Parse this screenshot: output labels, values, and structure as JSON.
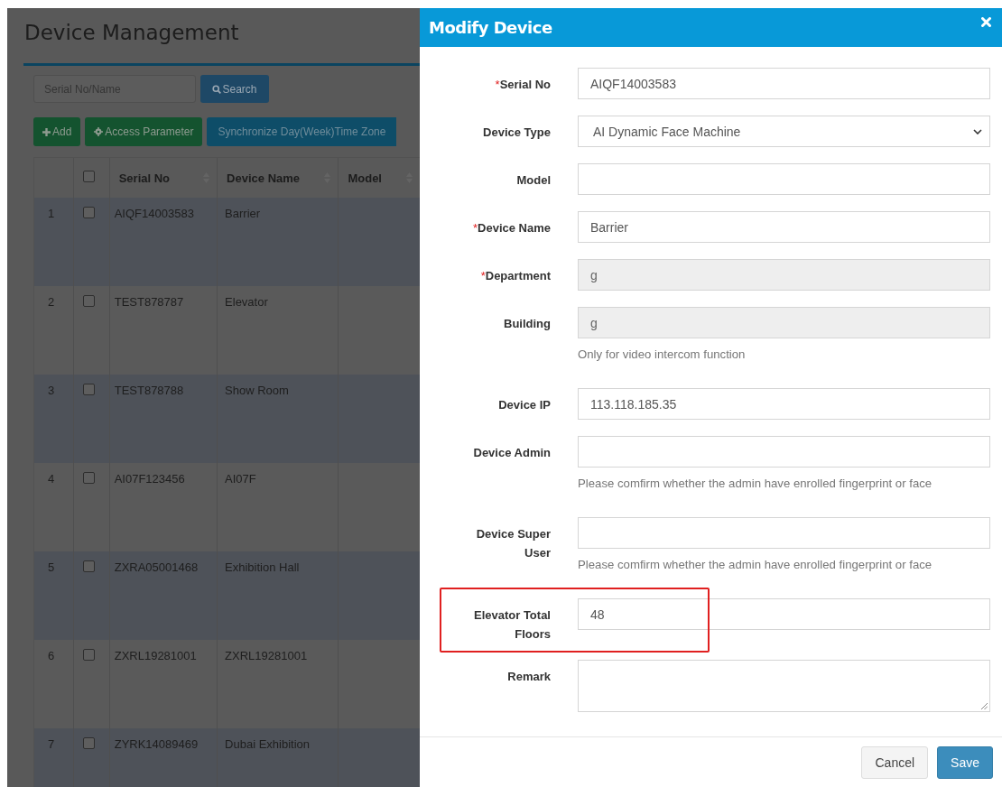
{
  "page": {
    "title": "Device Management",
    "search": {
      "placeholder": "Serial No/Name",
      "button": "Search"
    },
    "toolbar": [
      {
        "label": "Add",
        "kind": "add"
      },
      {
        "label": "Access Parameter",
        "kind": "settings"
      },
      {
        "label": "Synchronize Day(Week)Time Zone",
        "kind": "sync"
      }
    ],
    "table": {
      "columns": [
        {
          "label": "Serial No"
        },
        {
          "label": "Device Name"
        },
        {
          "label": "Model"
        }
      ],
      "header_checked": false,
      "rows": [
        {
          "index": "1",
          "checked": false,
          "serial": "AIQF14003583",
          "name": "Barrier"
        },
        {
          "index": "2",
          "checked": false,
          "serial": "TEST878787",
          "name": "Elevator"
        },
        {
          "index": "3",
          "checked": false,
          "serial": "TEST878788",
          "name": "Show Room"
        },
        {
          "index": "4",
          "checked": false,
          "serial": "AI07F123456",
          "name": "AI07F"
        },
        {
          "index": "5",
          "checked": false,
          "serial": "ZXRA05001468",
          "name": "Exhibition Hall"
        },
        {
          "index": "6",
          "checked": false,
          "serial": "ZXRL19281001",
          "name": "ZXRL19281001"
        },
        {
          "index": "7",
          "checked": false,
          "serial": "ZYRK14089469",
          "name": "Dubai Exhibition"
        }
      ]
    }
  },
  "dialog": {
    "title": "Modify Device",
    "fields": [
      {
        "label": "Serial No",
        "kind": "input",
        "marker": "*",
        "disabled": false,
        "highlighted": false,
        "value": "AIQF14003583"
      },
      {
        "label": "Device Type",
        "kind": "select",
        "disabled": false,
        "highlighted": false,
        "value": "AI Dynamic Face Machine"
      },
      {
        "label": "Model",
        "kind": "input",
        "disabled": false,
        "highlighted": false
      },
      {
        "label": "Device Name",
        "kind": "input",
        "marker": "*",
        "disabled": false,
        "highlighted": false,
        "value": "Barrier"
      },
      {
        "label": "Department",
        "kind": "input",
        "marker": "*",
        "disabled": true,
        "highlighted": false,
        "value": "g"
      },
      {
        "label": "Building",
        "kind": "input",
        "disabled": true,
        "highlighted": false,
        "value": "g",
        "hint": "Only for video intercom function"
      },
      {
        "label": "Device IP",
        "kind": "input",
        "disabled": false,
        "highlighted": false,
        "value": "113.118.185.35"
      },
      {
        "label": "Device Admin",
        "kind": "input",
        "disabled": false,
        "highlighted": false,
        "hint": "Please comfirm whether the admin have enrolled fingerprint or face"
      },
      {
        "label": "Device Super User",
        "kind": "input",
        "disabled": false,
        "highlighted": false,
        "hint": "Please comfirm whether the admin have enrolled fingerprint or face"
      },
      {
        "label": "Elevator Total Floors",
        "kind": "input",
        "disabled": false,
        "highlighted": true,
        "value": "48"
      },
      {
        "label": "Remark",
        "kind": "textarea",
        "disabled": false,
        "highlighted": false
      }
    ],
    "buttons": [
      {
        "label": "Cancel",
        "kind": "default"
      },
      {
        "label": "Save",
        "kind": "primary"
      }
    ]
  }
}
